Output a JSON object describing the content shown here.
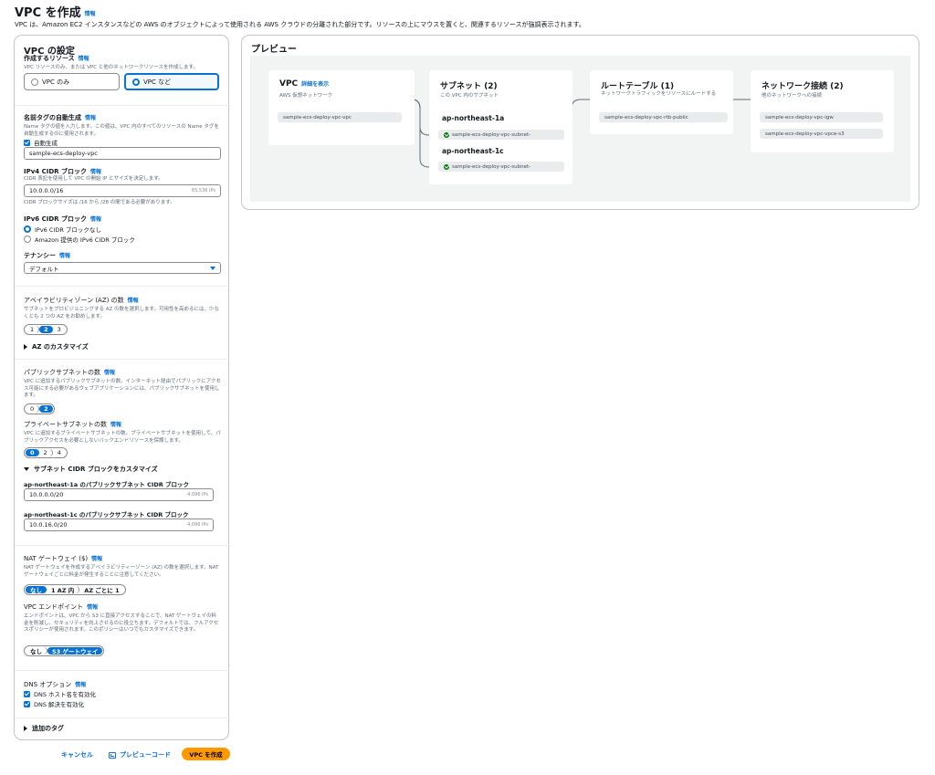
{
  "page": {
    "title": "VPC を作成",
    "title_info": "情報",
    "subtitle": "VPC は、Amazon EC2 インスタンスなどの AWS のオブジェクトによって使用される AWS クラウドの分離された部分です。リソースの上にマウスを置くと、関連するリソースが強調表示されます。"
  },
  "settings": {
    "heading": "VPC の設定",
    "resources": {
      "label": "作成するリソース",
      "info": "情報",
      "desc": "VPC リソースのみ、または VPC と他のネットワークリソースを作成します。",
      "options": [
        "VPC のみ",
        "VPC など"
      ],
      "selected": "VPC など"
    },
    "name_tag": {
      "label": "名前タグの自動生成",
      "info": "情報",
      "desc": "Name タグの値を入力します。この値は、VPC 内のすべてのリソースの Name タグを自動生成するのに使用されます。",
      "auto_label": "自動生成",
      "value": "sample-ecs-deploy-vpc"
    },
    "ipv4": {
      "label": "IPv4 CIDR ブロック",
      "info": "情報",
      "desc": "CIDR 表記を使用して VPC の開始 IP とサイズを決定します。",
      "value": "10.0.0.0/16",
      "hint": "65,536 IPs",
      "constraint": "CIDR ブロックサイズは /16 から /28 の間である必要があります。"
    },
    "ipv6": {
      "label": "IPv6 CIDR ブロック",
      "info": "情報",
      "options": [
        "IPv6 CIDR ブロックなし",
        "Amazon 提供の IPv6 CIDR ブロック"
      ],
      "selected": "IPv6 CIDR ブロックなし"
    },
    "tenancy": {
      "label": "テナンシー",
      "info": "情報",
      "value": "デフォルト"
    },
    "az": {
      "label": "アベイラビリティゾーン (AZ) の数",
      "info": "情報",
      "desc": "サブネットをプロビジョニングする AZ の数を選択します。可用性を高めるには、少なくとも 2 つの AZ をお勧めします。",
      "options": [
        "1",
        "2",
        "3"
      ],
      "selected": "2",
      "customize": "AZ のカスタマイズ"
    },
    "public_subnets": {
      "label": "パブリックサブネットの数",
      "info": "情報",
      "desc": "VPC に追加するパブリックサブネットの数。インターネット経由でパブリックにアクセス可能にする必要があるウェブアプリケーションには、パブリックサブネットを使用します。",
      "options": [
        "0",
        "2"
      ],
      "selected": "2"
    },
    "private_subnets": {
      "label": "プライベートサブネットの数",
      "info": "情報",
      "desc": "VPC に追加するプライベートサブネットの数。プライベートサブネットを使用して、パブリックアクセスを必要としないバックエンドリソースを保護します。",
      "options": [
        "0",
        "2",
        "4"
      ],
      "selected": "0"
    },
    "subnet_cidr": {
      "heading": "サブネット CIDR ブロックをカスタマイズ",
      "blocks": [
        {
          "label": "ap-northeast-1a のパブリックサブネット CIDR ブロック",
          "value": "10.0.0.0/20",
          "hint": "4,096 IPs"
        },
        {
          "label": "ap-northeast-1c のパブリックサブネット CIDR ブロック",
          "value": "10.0.16.0/20",
          "hint": "4,096 IPs"
        }
      ]
    },
    "nat": {
      "label": "NAT ゲートウェイ ($)",
      "info": "情報",
      "desc": "NAT ゲートウェイを作成するアベイラビリティーゾーン (AZ) の数を選択します。NAT ゲートウェイごとに料金が発生することに注意してください。",
      "options": [
        "なし",
        "1 AZ 内",
        "AZ ごとに 1"
      ],
      "selected": "なし"
    },
    "endpoint": {
      "label": "VPC エンドポイント",
      "info": "情報",
      "desc": "エンドポイントは、VPC から S3 に直接アクセスすることで、NAT ゲートウェイの料金を削減し、セキュリティを向上させるのに役立ちます。デフォルトでは、フルアクセスポリシーが使用されます。このポリシーはいつでもカスタマイズできます。",
      "options": [
        "なし",
        "S3 ゲートウェイ"
      ],
      "selected": "S3 ゲートウェイ"
    },
    "dns": {
      "label": "DNS オプション",
      "info": "情報",
      "hostnames": "DNS ホスト名を有効化",
      "resolution": "DNS 解決を有効化"
    },
    "tags": "追加のタグ"
  },
  "actions": {
    "cancel": "キャンセル",
    "preview_code": "プレビューコード",
    "create": "VPC を作成"
  },
  "preview": {
    "heading": "プレビュー",
    "vpc": {
      "title": "VPC",
      "link": "詳細を表示",
      "desc": "AWS 仮想ネットワーク",
      "item": "sample-ecs-deploy-vpc-vpc"
    },
    "subnets": {
      "title": "サブネット (2)",
      "desc": "この VPC 内のサブネット",
      "groups": [
        {
          "az": "ap-northeast-1a",
          "item": "sample-ecs-deploy-vpc-subnet-"
        },
        {
          "az": "ap-northeast-1c",
          "item": "sample-ecs-deploy-vpc-subnet-"
        }
      ]
    },
    "route_tables": {
      "title": "ルートテーブル (1)",
      "desc": "ネットワークトラフィックをリソースにルートする",
      "item": "sample-ecs-deploy-vpc-rtb-public"
    },
    "connections": {
      "title": "ネットワーク接続 (2)",
      "desc": "他のネットワークへの接続",
      "items": [
        "sample-ecs-deploy-vpc-igw",
        "sample-ecs-deploy-vpc-vpce-s3"
      ]
    }
  }
}
